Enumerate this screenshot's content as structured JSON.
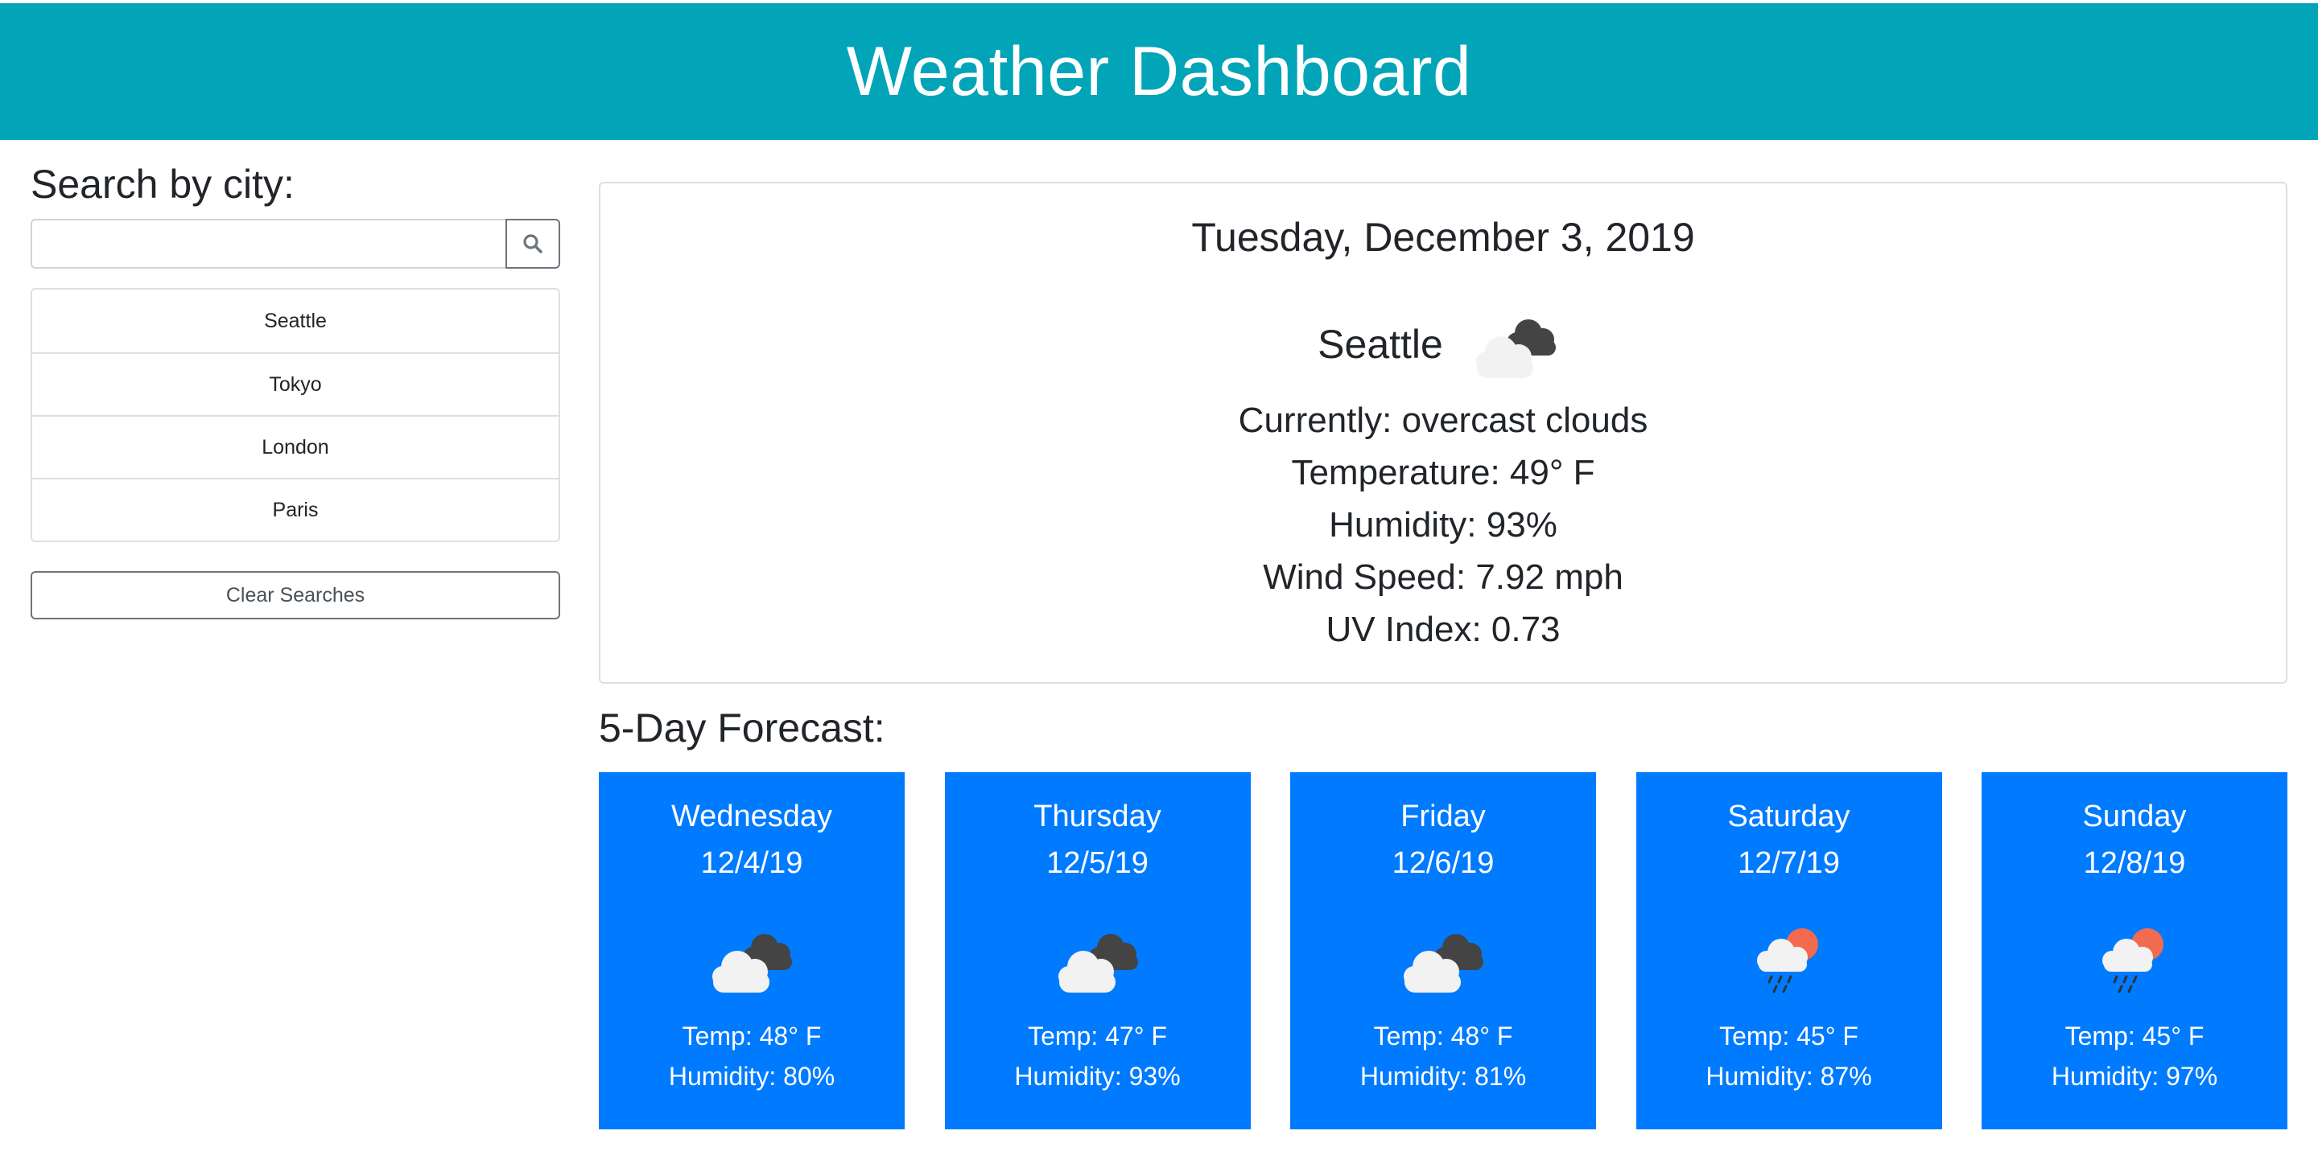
{
  "header": {
    "title": "Weather Dashboard"
  },
  "sidebar": {
    "title": "Search by city:",
    "search": {
      "value": "",
      "placeholder": "",
      "icon": "search-icon"
    },
    "history": [
      {
        "label": "Seattle"
      },
      {
        "label": "Tokyo"
      },
      {
        "label": "London"
      },
      {
        "label": "Paris"
      }
    ],
    "clear_label": "Clear Searches"
  },
  "current": {
    "date": "Tuesday, December 3, 2019",
    "city": "Seattle",
    "icon": "overcast-clouds-icon",
    "conditions": "Currently: overcast clouds",
    "temperature": "Temperature: 49° F",
    "humidity": "Humidity: 93%",
    "wind": "Wind Speed: 7.92 mph",
    "uv": "UV Index: 0.73"
  },
  "forecast": {
    "title": "5-Day Forecast:",
    "days": [
      {
        "day": "Wednesday",
        "date": "12/4/19",
        "icon": "overcast-clouds-icon",
        "temp": "Temp: 48° F",
        "humidity": "Humidity: 80%"
      },
      {
        "day": "Thursday",
        "date": "12/5/19",
        "icon": "overcast-clouds-icon",
        "temp": "Temp: 47° F",
        "humidity": "Humidity: 93%"
      },
      {
        "day": "Friday",
        "date": "12/6/19",
        "icon": "overcast-clouds-icon",
        "temp": "Temp: 48° F",
        "humidity": "Humidity: 81%"
      },
      {
        "day": "Saturday",
        "date": "12/7/19",
        "icon": "rain-sun-icon",
        "temp": "Temp: 45° F",
        "humidity": "Humidity: 87%"
      },
      {
        "day": "Sunday",
        "date": "12/8/19",
        "icon": "rain-sun-icon",
        "temp": "Temp: 45° F",
        "humidity": "Humidity: 97%"
      }
    ]
  },
  "colors": {
    "header_bg": "#02a4b8",
    "forecast_card_bg": "#007bff",
    "text": "#212529"
  }
}
